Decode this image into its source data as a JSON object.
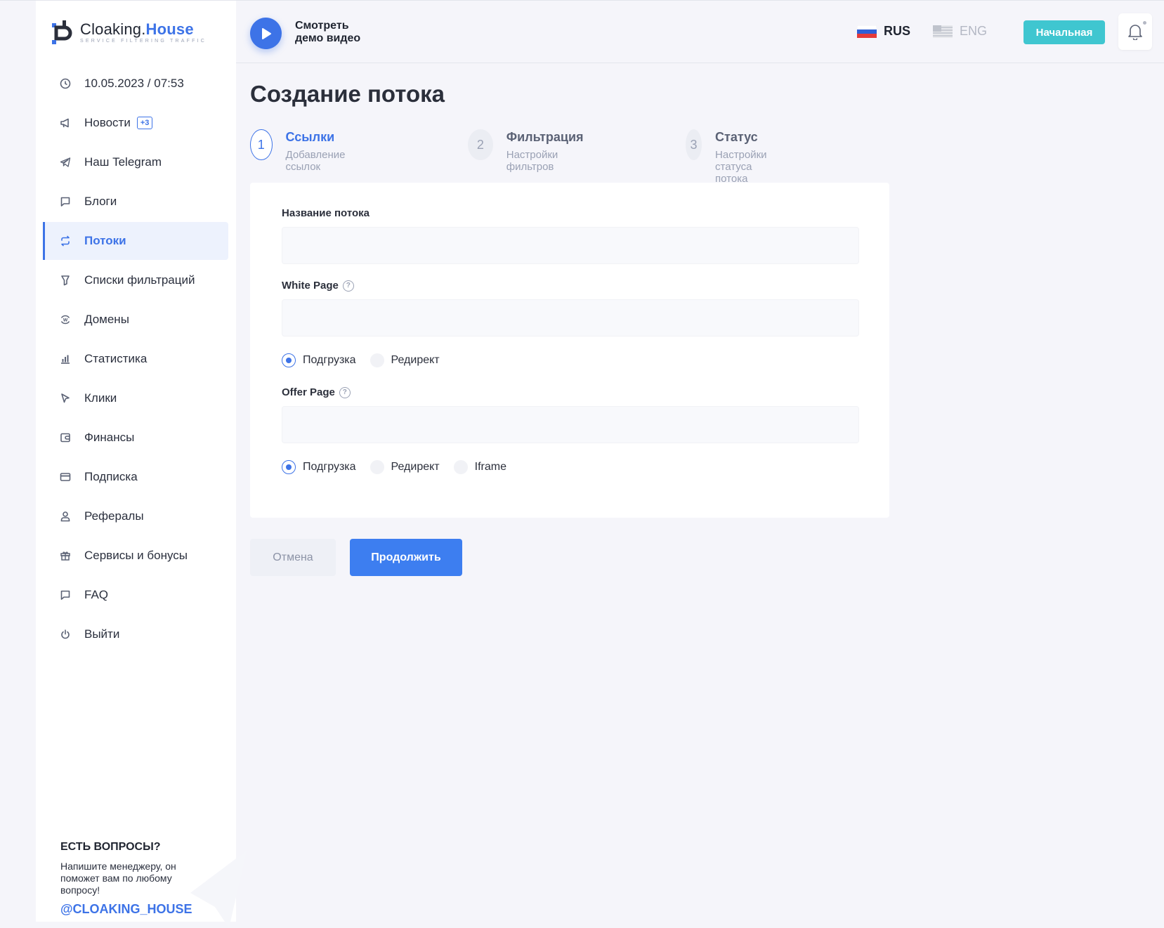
{
  "brand": {
    "name_part1": "Cloaking.",
    "name_part2": "House",
    "tagline": "SERVICE FILTERING TRAFFIC"
  },
  "sidebar": {
    "items": [
      {
        "label": "10.05.2023 / 07:53",
        "icon": "clock-icon"
      },
      {
        "label": "Новости",
        "icon": "megaphone-icon",
        "badge": "+3"
      },
      {
        "label": "Наш Telegram",
        "icon": "telegram-icon"
      },
      {
        "label": "Блоги",
        "icon": "chat-icon"
      },
      {
        "label": "Потоки",
        "icon": "sync-icon",
        "active": true
      },
      {
        "label": "Списки фильтраций",
        "icon": "filter-icon"
      },
      {
        "label": "Домены",
        "icon": "domain-icon"
      },
      {
        "label": "Статистика",
        "icon": "bar-chart-icon"
      },
      {
        "label": "Клики",
        "icon": "cursor-icon"
      },
      {
        "label": "Финансы",
        "icon": "wallet-icon"
      },
      {
        "label": "Подписка",
        "icon": "card-icon"
      },
      {
        "label": "Рефералы",
        "icon": "user-icon"
      },
      {
        "label": "Сервисы и бонусы",
        "icon": "gift-icon"
      },
      {
        "label": "FAQ",
        "icon": "chat-icon"
      },
      {
        "label": "Выйти",
        "icon": "power-icon"
      }
    ],
    "help": {
      "title": "ЕСТЬ ВОПРОСЫ?",
      "text": "Напишите менеджеру, он поможет вам по любому вопросу!",
      "link": "@CLOAKING_HOUSE"
    }
  },
  "header": {
    "demo_line1": "Смотреть",
    "demo_line2": "демо видео",
    "lang_rus": "RUS",
    "lang_eng": "ENG",
    "home_button": "Начальная"
  },
  "main": {
    "title": "Создание потока",
    "steps": [
      {
        "num": "1",
        "title": "Ссылки",
        "subtitle": "Добавление ссылок",
        "active": true
      },
      {
        "num": "2",
        "title": "Фильтрация",
        "subtitle": "Настройки фильтров"
      },
      {
        "num": "3",
        "title": "Статус",
        "subtitle": "Настройки статуса потока"
      }
    ],
    "form": {
      "name_label": "Название потока",
      "name_value": "",
      "white_label": "White Page",
      "white_value": "",
      "white_modes": [
        "Подгрузка",
        "Редирект"
      ],
      "white_selected": "Подгрузка",
      "offer_label": "Offer Page",
      "offer_value": "",
      "offer_modes": [
        "Подгрузка",
        "Редирект",
        "Iframe"
      ],
      "offer_selected": "Подгрузка"
    },
    "cancel_button": "Отмена",
    "continue_button": "Продолжить"
  },
  "colors": {
    "accent": "#3d73e7",
    "home_button": "#3fc6d0",
    "background": "#f5f5fa"
  }
}
